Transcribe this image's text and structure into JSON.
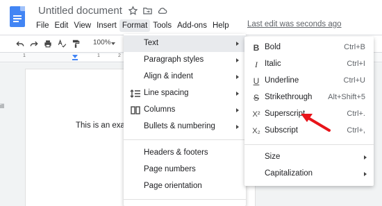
{
  "doc": {
    "title": "Untitled document",
    "last_edit": "Last edit was seconds ago",
    "body_text": "This is an exa",
    "left_hint": "ill"
  },
  "menubar": [
    "File",
    "Edit",
    "View",
    "Insert",
    "Format",
    "Tools",
    "Add-ons",
    "Help"
  ],
  "toolbar": {
    "zoom": "100%"
  },
  "ruler": {
    "numbers": [
      "1",
      "1",
      "2"
    ]
  },
  "format_menu": {
    "items": [
      {
        "label": "Text",
        "arrow": true,
        "highlighted": true
      },
      {
        "label": "Paragraph styles",
        "arrow": true
      },
      {
        "label": "Align & indent",
        "arrow": true
      },
      {
        "label": "Line spacing",
        "arrow": true,
        "icon": "line-spacing-icon"
      },
      {
        "label": "Columns",
        "arrow": true,
        "icon": "columns-icon"
      },
      {
        "label": "Bullets & numbering",
        "arrow": true
      },
      {
        "label": "Headers & footers"
      },
      {
        "label": "Page numbers"
      },
      {
        "label": "Page orientation"
      }
    ]
  },
  "text_submenu": {
    "items": [
      {
        "label": "Bold",
        "shortcut": "Ctrl+B",
        "icon": "bold-icon",
        "glyph": "B"
      },
      {
        "label": "Italic",
        "shortcut": "Ctrl+I",
        "icon": "italic-icon",
        "glyph": "I"
      },
      {
        "label": "Underline",
        "shortcut": "Ctrl+U",
        "icon": "underline-icon",
        "glyph": "U"
      },
      {
        "label": "Strikethrough",
        "shortcut": "Alt+Shift+5",
        "icon": "strikethrough-icon",
        "glyph": "S"
      },
      {
        "label": "Superscript",
        "shortcut": "Ctrl+.",
        "icon": "superscript-icon",
        "glyph": "X²"
      },
      {
        "label": "Subscript",
        "shortcut": "Ctrl+,",
        "icon": "subscript-icon",
        "glyph": "X₂"
      },
      {
        "label": "Size",
        "arrow": true
      },
      {
        "label": "Capitalization",
        "arrow": true
      }
    ]
  },
  "colors": {
    "accent": "#4285f4",
    "annotation": "#e8141a",
    "highlight": "#e8eaed"
  }
}
